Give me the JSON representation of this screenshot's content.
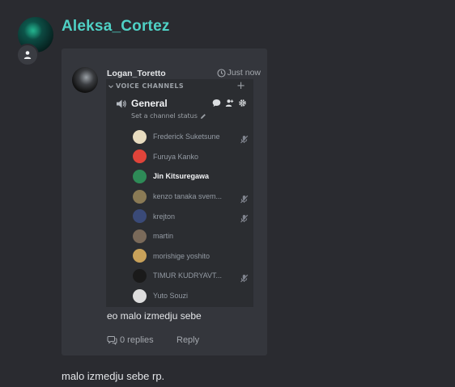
{
  "message": {
    "author": "Aleksa_Cortez",
    "text": "malo izmedju sebe rp."
  },
  "embed": {
    "author": "Logan_Toretto",
    "timestamp": "Just now",
    "text": "eo malo izmedju sebe",
    "replies": "0 replies",
    "reply_label": "Reply"
  },
  "voice": {
    "section_label": "VOICE CHANNELS",
    "channel_name": "General",
    "status_placeholder": "Set a channel status",
    "members": [
      {
        "name": "Frederick Suketsune",
        "muted": true,
        "active": false,
        "color": "#e8dcc0"
      },
      {
        "name": "Furuya Kanko",
        "muted": false,
        "active": false,
        "color": "#e0443a"
      },
      {
        "name": "Jin Kitsuregawa",
        "muted": false,
        "active": true,
        "color": "#2e8b57"
      },
      {
        "name": "kenzo tanaka svem...",
        "muted": true,
        "active": false,
        "color": "#8a7a55"
      },
      {
        "name": "krejton",
        "muted": true,
        "active": false,
        "color": "#3a4a78"
      },
      {
        "name": "martin",
        "muted": false,
        "active": false,
        "color": "#7a6a5a"
      },
      {
        "name": "morishige yoshito",
        "muted": false,
        "active": false,
        "color": "#c9a25a"
      },
      {
        "name": "TIMUR KUDRYAVT...",
        "muted": true,
        "active": false,
        "color": "#1a1a1a"
      },
      {
        "name": "Yuto Souzi",
        "muted": false,
        "active": false,
        "color": "#ddd"
      }
    ]
  },
  "colors": {
    "author_name": "#4fd1c5",
    "background": "#2a2b30",
    "card": "#34363c"
  }
}
